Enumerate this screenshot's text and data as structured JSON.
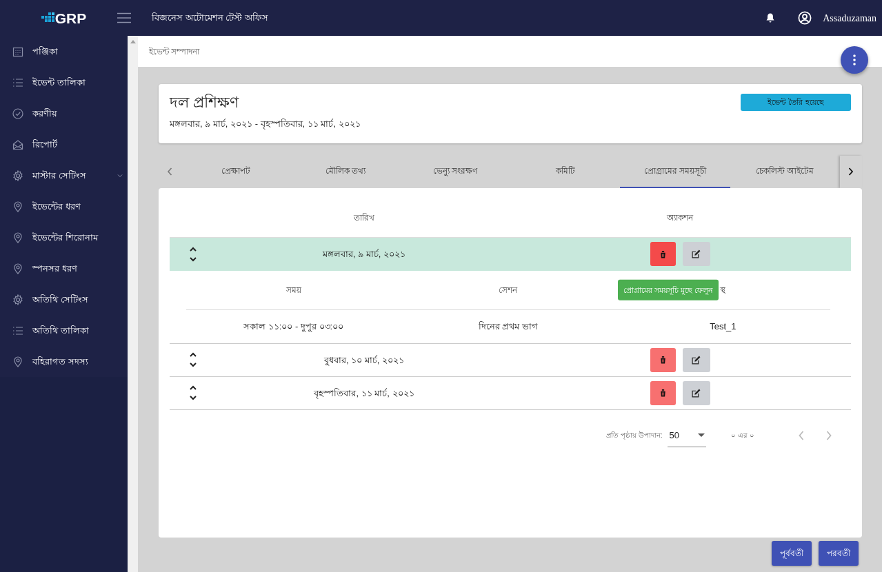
{
  "topbar": {
    "logo": "GRP",
    "office": "বিজনেস অটোমেশন টেস্ট অফিস",
    "user": "Assaduzaman"
  },
  "sidebar": {
    "items": [
      {
        "label": "পঞ্জিকা",
        "kind": "calendar"
      },
      {
        "label": "ইভেন্ট তালিকা",
        "kind": "list"
      },
      {
        "label": "করণীয়",
        "kind": "check"
      },
      {
        "label": "রিপোর্ট",
        "kind": "report"
      },
      {
        "label": "মাস্টার সেটিংস",
        "kind": "gear",
        "expanded": true,
        "children": [
          {
            "label": "ইভেন্টের ধরণ",
            "kind": "pin"
          },
          {
            "label": "ইভেন্টের শিরোনাম",
            "kind": "pin"
          },
          {
            "label": "স্পনসর ধরণ",
            "kind": "pin"
          },
          {
            "label": "অতিথি সেটিংস",
            "kind": "gear"
          },
          {
            "label": "অতিথি তালিকা",
            "kind": "list"
          },
          {
            "label": "বহিরাগত সদস্য",
            "kind": "pin"
          }
        ]
      }
    ]
  },
  "breadcrumb": "ইভেন্ট সম্পাদনা",
  "event": {
    "title": "দল প্রশিক্ষণ",
    "dates": "মঙ্গলবার, ৯ মার্চ, ২০২১ - বৃহস্পতিবার, ১১ মার্চ, ২০২১",
    "status": "ইভেন্ট তৈরি হয়েছে"
  },
  "tabs": [
    {
      "label": "প্রেক্ষাপট",
      "selected": false
    },
    {
      "label": "মৌলিক তথ্য",
      "selected": false
    },
    {
      "label": "ভেন্যু সংরক্ষণ",
      "selected": false
    },
    {
      "label": "কমিটি",
      "selected": false
    },
    {
      "label": "প্রোগ্রামের সময়সূচী",
      "selected": true
    },
    {
      "label": "চেকলিস্ট আইটেম",
      "selected": false
    }
  ],
  "table": {
    "columns": [
      "তারিখ",
      "অ্যাকশন"
    ],
    "rows": [
      {
        "date": "মঙ্গলবার, ৯ মার্চ, ২০২১",
        "expanded": true,
        "delete_hovered": true,
        "detail": {
          "columns": [
            "সময়",
            "সেশন",
            "স্থ"
          ],
          "rows": [
            [
              "সকাল ১১:০০ - দুপুর ০৩:০০",
              "দিনের প্রথম ভাগ",
              "Test_1"
            ]
          ]
        }
      },
      {
        "date": "বুধবার, ১০ মার্চ, ২০২১",
        "expanded": false,
        "delete_hovered": false
      },
      {
        "date": "বৃহস্পতিবার, ১১ মার্চ, ২০২১",
        "expanded": false,
        "delete_hovered": false
      }
    ]
  },
  "tooltip": "প্রোগ্রামের সময়সূচি মুছে ফেলুন",
  "pagination": {
    "label": "প্রতি পৃষ্ঠায় উপাদান:",
    "page_size": "50",
    "range": "০ এর ০"
  },
  "buttons": [
    "পূর্ববর্তী",
    "পরবর্তী"
  ]
}
